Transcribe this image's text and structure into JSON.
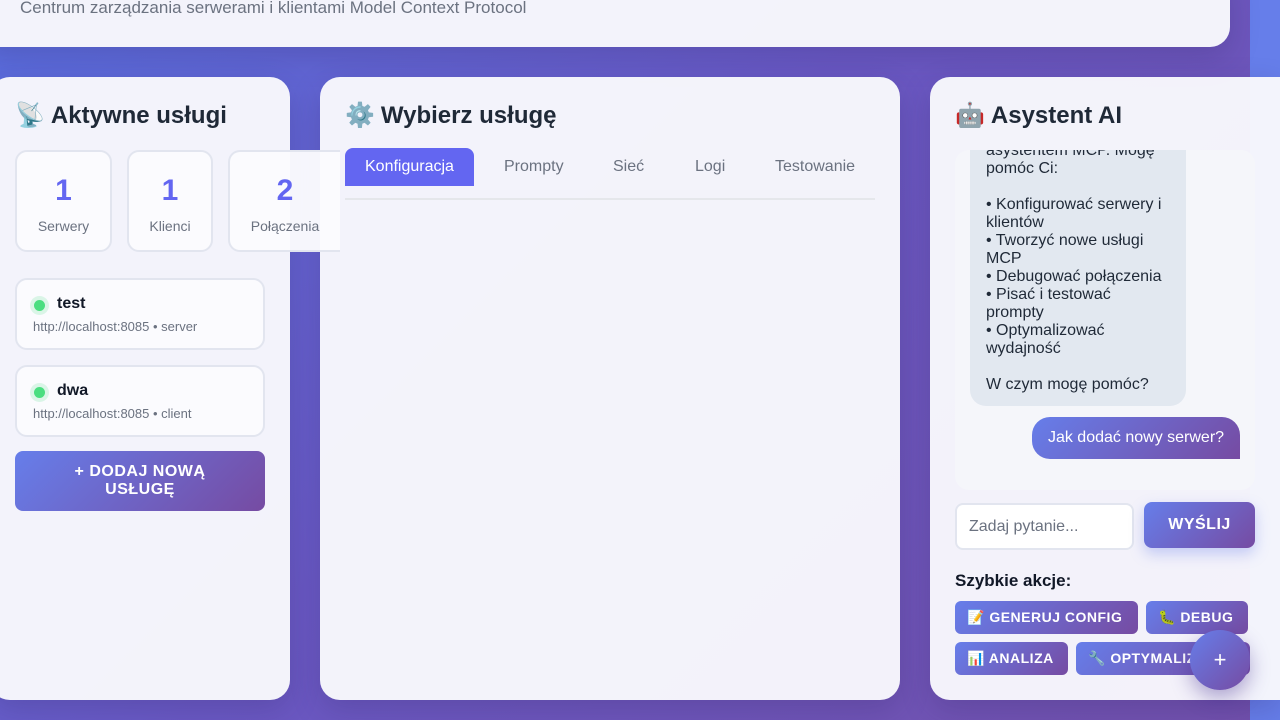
{
  "header": {
    "subtitle": "Centrum zarządzania serwerami i klientami Model Context Protocol"
  },
  "services_panel": {
    "icon": "satellite-antenna-icon",
    "icon_glyph": "📡",
    "title": "Aktywne usługi",
    "stats": [
      {
        "value": "1",
        "label": "Serwery"
      },
      {
        "value": "1",
        "label": "Klienci"
      },
      {
        "value": "2",
        "label": "Połączenia"
      }
    ],
    "items": [
      {
        "name": "test",
        "meta": "http://localhost:8085 • server",
        "status": "online"
      },
      {
        "name": "dwa",
        "meta": "http://localhost:8085 • client",
        "status": "online"
      }
    ],
    "add_button": "+ DODAJ NOWĄ USŁUGĘ"
  },
  "main_panel": {
    "icon": "gear-icon",
    "icon_glyph": "⚙️",
    "title": "Wybierz usługę",
    "tabs": [
      {
        "label": "Konfiguracja",
        "active": true
      },
      {
        "label": "Prompty",
        "active": false
      },
      {
        "label": "Sieć",
        "active": false
      },
      {
        "label": "Logi",
        "active": false
      },
      {
        "label": "Testowanie",
        "active": false
      }
    ]
  },
  "assistant": {
    "icon": "robot-icon",
    "icon_glyph": "🤖",
    "title": "Asystent AI",
    "bot_message": "asystentem MCP. Mogę pomóc Ci:\n\n• Konfigurować serwery i klientów\n• Tworzyć nowe usługi MCP\n• Debugować połączenia\n• Pisać i testować prompty\n• Optymalizować wydajność\n\nW czym mogę pomóc?",
    "user_message": "Jak dodać nowy serwer?",
    "input_placeholder": "Zadaj pytanie...",
    "send_button": "WYŚLIJ",
    "quick_actions_title": "Szybkie akcje:",
    "quick_actions": [
      {
        "label": "📝 GENERUJ CONFIG",
        "icon": "memo-icon"
      },
      {
        "label": "🐛 DEBUG",
        "icon": "bug-icon"
      },
      {
        "label": "📊 ANALIZA",
        "icon": "bar-chart-icon"
      },
      {
        "label": "🔧 OPTYMALIZACJA",
        "icon": "wrench-icon"
      }
    ],
    "fab_glyph": "+"
  },
  "colors": {
    "accent": "#6366f1",
    "gradient_start": "#667eea",
    "gradient_end": "#764ba2",
    "status_online": "#4ade80"
  }
}
